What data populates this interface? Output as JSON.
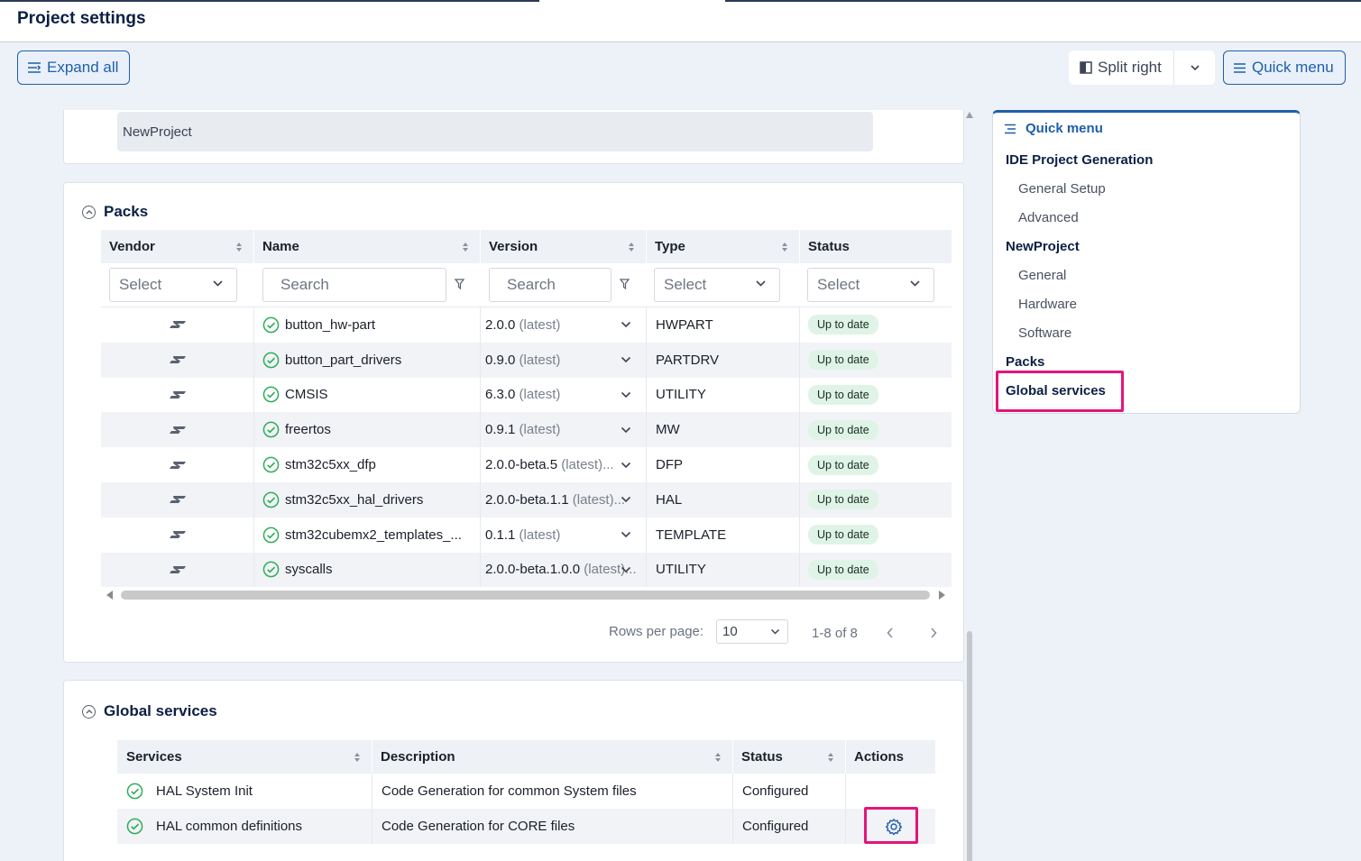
{
  "header": {
    "title": "Project settings"
  },
  "toolbar": {
    "expand_all": "Expand all",
    "split_right": "Split right",
    "quick_menu": "Quick menu"
  },
  "project": {
    "name": "NewProject"
  },
  "packs": {
    "title": "Packs",
    "columns": [
      "Vendor",
      "Name",
      "Version",
      "Type",
      "Status"
    ],
    "filters": {
      "vendor": "Select",
      "name": "Search",
      "version": "Search",
      "type": "Select",
      "status": "Select"
    },
    "rows": [
      {
        "name": "button_hw-part",
        "version": "2.0.0",
        "latest": "(latest)",
        "type": "HWPART",
        "status": "Up to date"
      },
      {
        "name": "button_part_drivers",
        "version": "0.9.0",
        "latest": "(latest)",
        "type": "PARTDRV",
        "status": "Up to date"
      },
      {
        "name": "CMSIS",
        "version": "6.3.0",
        "latest": "(latest)",
        "type": "UTILITY",
        "status": "Up to date"
      },
      {
        "name": "freertos",
        "version": "0.9.1",
        "latest": "(latest)",
        "type": "MW",
        "status": "Up to date"
      },
      {
        "name": "stm32c5xx_dfp",
        "version": "2.0.0-beta.5",
        "latest": "(latest)...",
        "type": "DFP",
        "status": "Up to date"
      },
      {
        "name": "stm32c5xx_hal_drivers",
        "version": "2.0.0-beta.1.1",
        "latest": "(latest)...",
        "type": "HAL",
        "status": "Up to date"
      },
      {
        "name": "stm32cubemx2_templates_...",
        "version": "0.1.1",
        "latest": "(latest)",
        "type": "TEMPLATE",
        "status": "Up to date"
      },
      {
        "name": "syscalls",
        "version": "2.0.0-beta.1.0.0",
        "latest": "(latest)...",
        "type": "UTILITY",
        "status": "Up to date"
      }
    ],
    "pagination": {
      "rows_per_page_label": "Rows per page:",
      "rows_per_page": "10",
      "range": "1-8 of 8"
    }
  },
  "global_services": {
    "title": "Global services",
    "columns": [
      "Services",
      "Description",
      "Status",
      "Actions"
    ],
    "rows": [
      {
        "service": "HAL System Init",
        "description": "Code Generation for common System files",
        "status": "Configured"
      },
      {
        "service": "HAL common definitions",
        "description": "Code Generation for CORE files",
        "status": "Configured"
      }
    ]
  },
  "quick_menu": {
    "title": "Quick menu",
    "items": [
      {
        "label": "IDE Project Generation",
        "level": 1
      },
      {
        "label": "General Setup",
        "level": 2
      },
      {
        "label": "Advanced",
        "level": 2
      },
      {
        "label": "NewProject",
        "level": 1
      },
      {
        "label": "General",
        "level": 2
      },
      {
        "label": "Hardware",
        "level": 2
      },
      {
        "label": "Software",
        "level": 2
      },
      {
        "label": "Packs",
        "level": 1
      },
      {
        "label": "Global services",
        "level": 1
      }
    ]
  },
  "colors": {
    "accent": "#1f5fa8",
    "highlight": "#e4157c",
    "status_ok": "#dff4e7",
    "check_green": "#2fae5a"
  },
  "icons": {
    "vendor_logo": "st-logo-icon",
    "row_status": "check-circle-icon",
    "action": "gear-icon"
  }
}
